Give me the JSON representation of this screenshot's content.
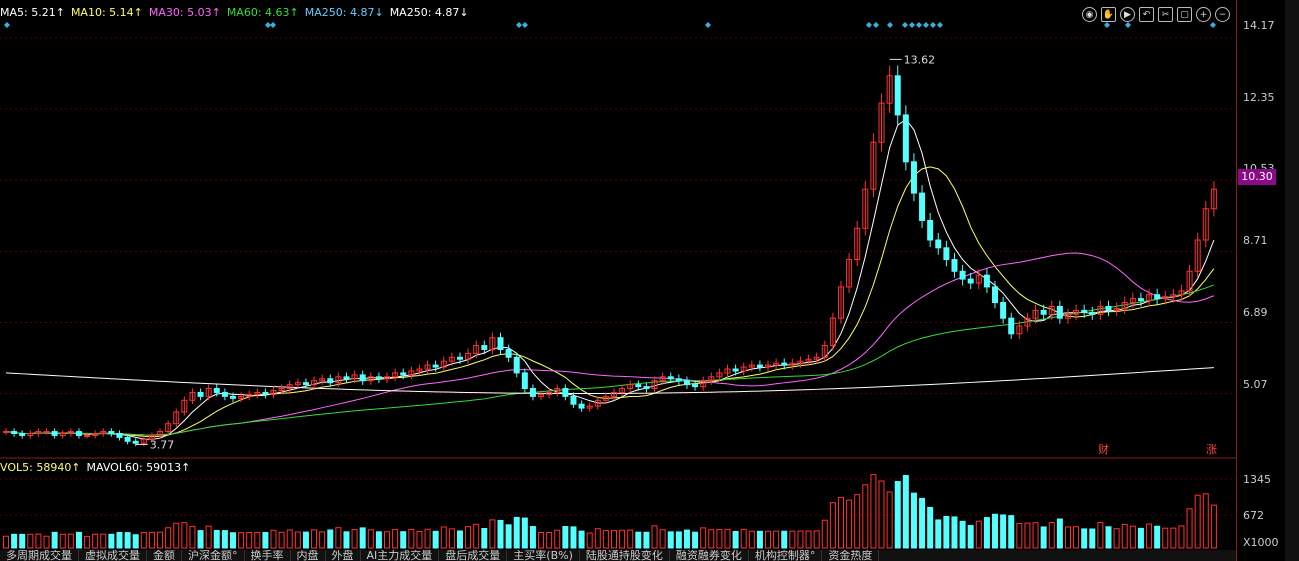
{
  "legend": [
    {
      "label": "MA5: 5.21↑",
      "color": "#ffffff"
    },
    {
      "label": "MA10: 5.14↑",
      "color": "#ffff66"
    },
    {
      "label": "MA30: 5.03↑",
      "color": "#ff66ff"
    },
    {
      "label": "MA60: 4.63↑",
      "color": "#33dd33"
    },
    {
      "label": "MA250: 4.87↓",
      "color": "#66ccff"
    },
    {
      "label": "MA250: 4.87↓",
      "color": "#ffffff"
    }
  ],
  "vol_legend": [
    {
      "label": "VOL5: 58940↑",
      "color": "#ffff66"
    },
    {
      "label": "MAVOL60: 59013↑",
      "color": "#ffffff"
    }
  ],
  "toolbar_icons": [
    "eye-icon",
    "hand-icon",
    "play-icon",
    "undo-icon",
    "scissors-icon",
    "lock-icon",
    "zoom-in-icon",
    "zoom-out-icon"
  ],
  "axis": {
    "price_ticks": [
      "14.17",
      "12.35",
      "10.53",
      "8.71",
      "6.89",
      "5.07"
    ],
    "current_price": "10.30",
    "volume_ticks": [
      "1345",
      "672",
      "X1000"
    ]
  },
  "annotations": {
    "high_label": "13.62",
    "low_label": "3.77",
    "finance_mark": "财",
    "limit_up_mark": "涨"
  },
  "bottom_tabs": [
    "多周期成交量",
    "虚拟成交量",
    "金额",
    "沪深金额°",
    "换手率",
    "内盘",
    "外盘",
    "AI主力成交量",
    "盘后成交量",
    "主买率(B%)",
    "陆股通持股变化",
    "融资融券变化",
    "机构控制器°",
    "资金热度"
  ],
  "chart_data": {
    "type": "candlestick",
    "price_range": [
      3.5,
      14.5
    ],
    "high": 13.62,
    "low": 3.77,
    "last": 10.3,
    "closes": [
      4.1,
      4.05,
      4.0,
      4.05,
      4.1,
      4.1,
      4.0,
      4.05,
      4.1,
      4.0,
      4.0,
      4.05,
      4.1,
      4.05,
      3.95,
      3.85,
      3.8,
      3.9,
      4.0,
      4.1,
      4.3,
      4.6,
      4.9,
      5.1,
      5.0,
      5.2,
      5.1,
      5.0,
      4.95,
      5.0,
      5.05,
      5.1,
      5.05,
      5.15,
      5.2,
      5.3,
      5.35,
      5.3,
      5.4,
      5.45,
      5.35,
      5.5,
      5.45,
      5.55,
      5.4,
      5.5,
      5.45,
      5.5,
      5.6,
      5.55,
      5.65,
      5.7,
      5.8,
      5.75,
      5.9,
      6.0,
      5.95,
      6.1,
      6.3,
      6.2,
      6.5,
      6.2,
      6.0,
      5.6,
      5.2,
      5.0,
      5.05,
      5.1,
      5.2,
      5.0,
      4.8,
      4.7,
      4.75,
      4.9,
      5.0,
      5.1,
      5.2,
      5.3,
      5.25,
      5.2,
      5.4,
      5.5,
      5.45,
      5.4,
      5.3,
      5.25,
      5.4,
      5.5,
      5.6,
      5.7,
      5.65,
      5.75,
      5.8,
      5.75,
      5.8,
      5.85,
      5.8,
      5.85,
      5.9,
      5.95,
      6.0,
      6.3,
      7.0,
      7.8,
      8.5,
      9.3,
      10.3,
      11.5,
      12.5,
      13.2,
      12.2,
      11.0,
      10.2,
      9.5,
      9.0,
      8.8,
      8.5,
      8.2,
      8.0,
      7.9,
      8.1,
      7.8,
      7.4,
      7.0,
      6.6,
      6.8,
      7.0,
      7.2,
      7.1,
      7.3,
      7.0,
      7.1,
      7.2,
      7.15,
      7.1,
      7.3,
      7.2,
      7.25,
      7.4,
      7.5,
      7.45,
      7.6,
      7.5,
      7.55,
      7.6,
      7.7,
      8.2,
      9.0,
      9.8,
      10.3
    ],
    "ma_lines": [
      "MA5",
      "MA10",
      "MA30",
      "MA60",
      "MA250"
    ],
    "volume_range": [
      0,
      1345
    ]
  }
}
